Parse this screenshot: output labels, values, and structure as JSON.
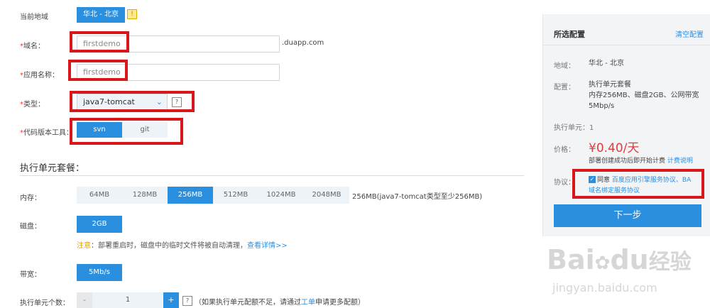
{
  "region": {
    "label": "当前地域",
    "value": "华北 - 北京",
    "warning_icon": "warning-icon"
  },
  "domain": {
    "required": "*",
    "label": "域名",
    "value": "firstdemo",
    "suffix": ".duapp.com"
  },
  "app_name": {
    "required": "*",
    "label": "应用名称",
    "value": "firstdemo"
  },
  "type": {
    "required": "*",
    "label": "类型",
    "value": "java7-tomcat",
    "help": "?"
  },
  "vcs": {
    "required": "*",
    "label": "代码版本工具",
    "options": [
      "svn",
      "git"
    ],
    "selected": "svn"
  },
  "package": {
    "heading": "执行单元套餐",
    "memory": {
      "label": "内存",
      "options": [
        "64MB",
        "128MB",
        "256MB",
        "512MB",
        "1024MB",
        "2048MB"
      ],
      "selected": "256MB",
      "note": "256MB(java7-tomcat类型至少256MB)"
    },
    "disk": {
      "label": "磁盘",
      "value": "2GB",
      "notice_prefix": "注意",
      "notice_text": "部署重启时，磁盘中的临时文件将被自动清理，",
      "notice_link": "查看详情>>"
    },
    "bandwidth": {
      "label": "带宽",
      "value": "5Mb/s"
    },
    "count": {
      "label": "执行单元个数",
      "minus": "-",
      "value": "1",
      "plus": "+",
      "help": "?",
      "note_prefix": "（如果执行单元配额不足，请通过",
      "note_link": "工单",
      "note_suffix": "申请更多配额）"
    }
  },
  "summary": {
    "title": "所选配置",
    "clear": "清空配置",
    "region_key": "地域",
    "region_val": "华北 - 北京",
    "config_key": "配置",
    "config_line1": "执行单元套餐",
    "config_line2": "内存256MB、磁盘2GB、公网带宽",
    "config_line3": "5Mbp/s",
    "units": "执行单元：1",
    "price_key": "价格",
    "price": "¥0.40/天",
    "price_note": "部署创建成功后即开始计费",
    "price_link": "计费说明",
    "agreement_key": "协议",
    "agree_text": "同意",
    "agree_link1": "百度应用引擎服务协议、BA",
    "agree_link2": "域名绑定服务协议",
    "next": "下一步"
  },
  "watermark": {
    "brand": "Bai",
    "brand2": "du",
    "brand_cn": "经验",
    "url": "jingyan.baidu.com"
  },
  "colors": {
    "accent": "#2b8fe0",
    "highlight": "#d9161a",
    "price": "#e23b3b"
  }
}
